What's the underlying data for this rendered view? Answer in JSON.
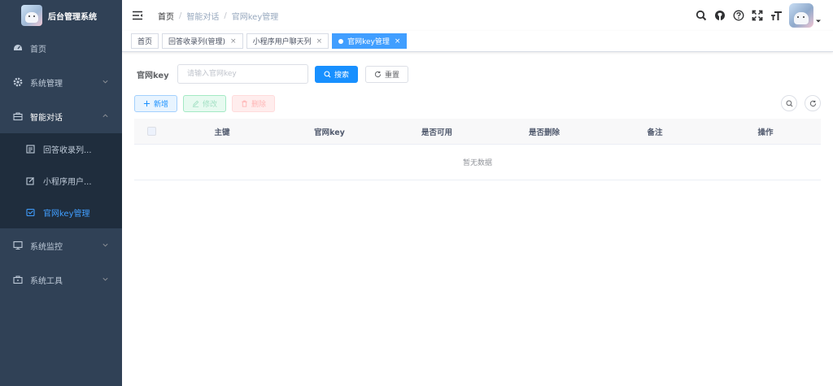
{
  "app": {
    "title": "后台管理系统"
  },
  "sidebar": {
    "items": [
      {
        "label": "首页",
        "icon": "dashboard-icon"
      },
      {
        "label": "系统管理",
        "icon": "system-gear-icon"
      },
      {
        "label": "智能对话",
        "icon": "briefcase-icon",
        "children": [
          {
            "label": "回答收录列...",
            "icon": "list-icon"
          },
          {
            "label": "小程序用户...",
            "icon": "edit-icon"
          },
          {
            "label": "官网key管理",
            "icon": "checkbox-icon"
          }
        ]
      },
      {
        "label": "系统监控",
        "icon": "monitor-icon"
      },
      {
        "label": "系统工具",
        "icon": "tool-icon"
      }
    ]
  },
  "navbar": {
    "breadcrumb": [
      "首页",
      "智能对话",
      "官网key管理"
    ],
    "separator": "/"
  },
  "tags": [
    {
      "label": "首页",
      "closable": false
    },
    {
      "label": "回答收录列(管理)",
      "closable": true
    },
    {
      "label": "小程序用户聊天列",
      "closable": true
    },
    {
      "label": "官网key管理",
      "closable": true,
      "active": true
    }
  ],
  "tag_close": "×",
  "search": {
    "label": "官网key",
    "placeholder": "请输入官网key",
    "search_btn": "搜索",
    "reset_btn": "重置"
  },
  "toolbar": {
    "add": "新增",
    "edit": "修改",
    "delete": "删除"
  },
  "table": {
    "columns": [
      "主键",
      "官网key",
      "是否可用",
      "是否删除",
      "备注",
      "操作"
    ],
    "empty_text": "暂无数据"
  },
  "colors": {
    "sidebar_bg": "#304156",
    "submenu_bg": "#1f2d3d",
    "primary": "#1890ff",
    "active_menu": "#409eff"
  }
}
